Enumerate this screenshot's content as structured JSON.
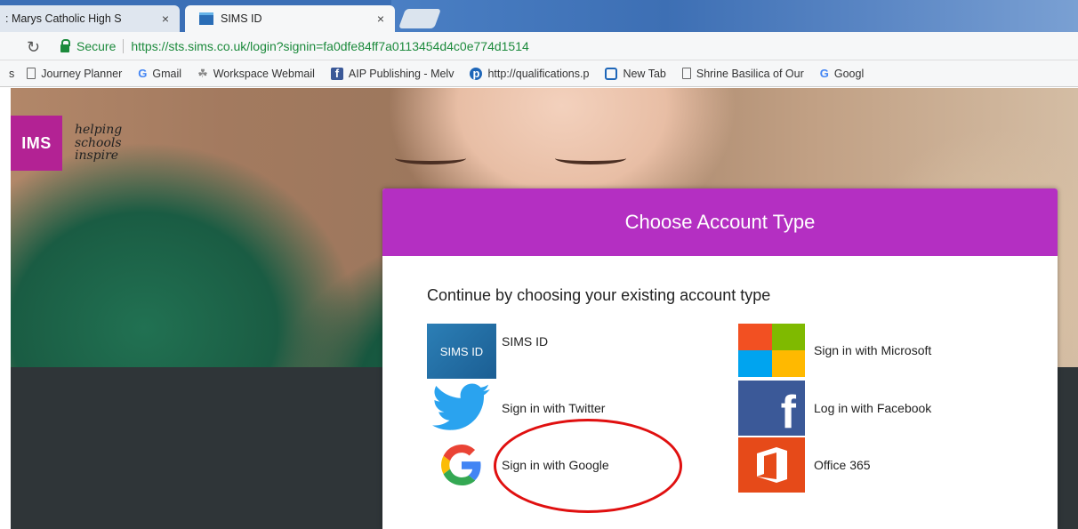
{
  "browser": {
    "tabs": [
      {
        "label": ": Marys Catholic High S",
        "close": "×"
      },
      {
        "label": "SIMS ID",
        "close": "×"
      }
    ],
    "secure_label": "Secure",
    "url": "https://sts.sims.co.uk/login?signin=fa0dfe84ff7a0113454d4c0e774d1514",
    "reload_icon": "reload-icon",
    "bookmarks": [
      {
        "label": "s",
        "icon": "none"
      },
      {
        "label": "Journey Planner",
        "icon": "page-icon"
      },
      {
        "label": "Gmail",
        "icon": "google-icon"
      },
      {
        "label": "Workspace Webmail",
        "icon": "webmail-icon"
      },
      {
        "label": "AIP Publishing - Melv",
        "icon": "facebook-icon"
      },
      {
        "label": "http://qualifications.p",
        "icon": "pearson-icon"
      },
      {
        "label": "New Tab",
        "icon": "newtab-icon"
      },
      {
        "label": "Shrine Basilica of Our",
        "icon": "page-icon"
      },
      {
        "label": "Googl",
        "icon": "google-icon"
      }
    ]
  },
  "page": {
    "logo": {
      "brand": "IMS",
      "tagline": [
        "helping",
        "schools",
        "inspire"
      ]
    },
    "modal": {
      "title": "Choose Account Type",
      "subtitle": "Continue by choosing your existing account type",
      "options": [
        {
          "label": "SIMS ID",
          "tile": "SIMS ID"
        },
        {
          "label": "Sign in with Microsoft"
        },
        {
          "label": "Sign in with Twitter"
        },
        {
          "label": "Log in with Facebook"
        },
        {
          "label": "Sign in with Google"
        },
        {
          "label": "Office 365"
        }
      ]
    }
  },
  "colors": {
    "modal_header": "#b42fc2",
    "sims_logo": "#b32294",
    "annotation": "#e01010",
    "secure": "#1c8a3c"
  }
}
